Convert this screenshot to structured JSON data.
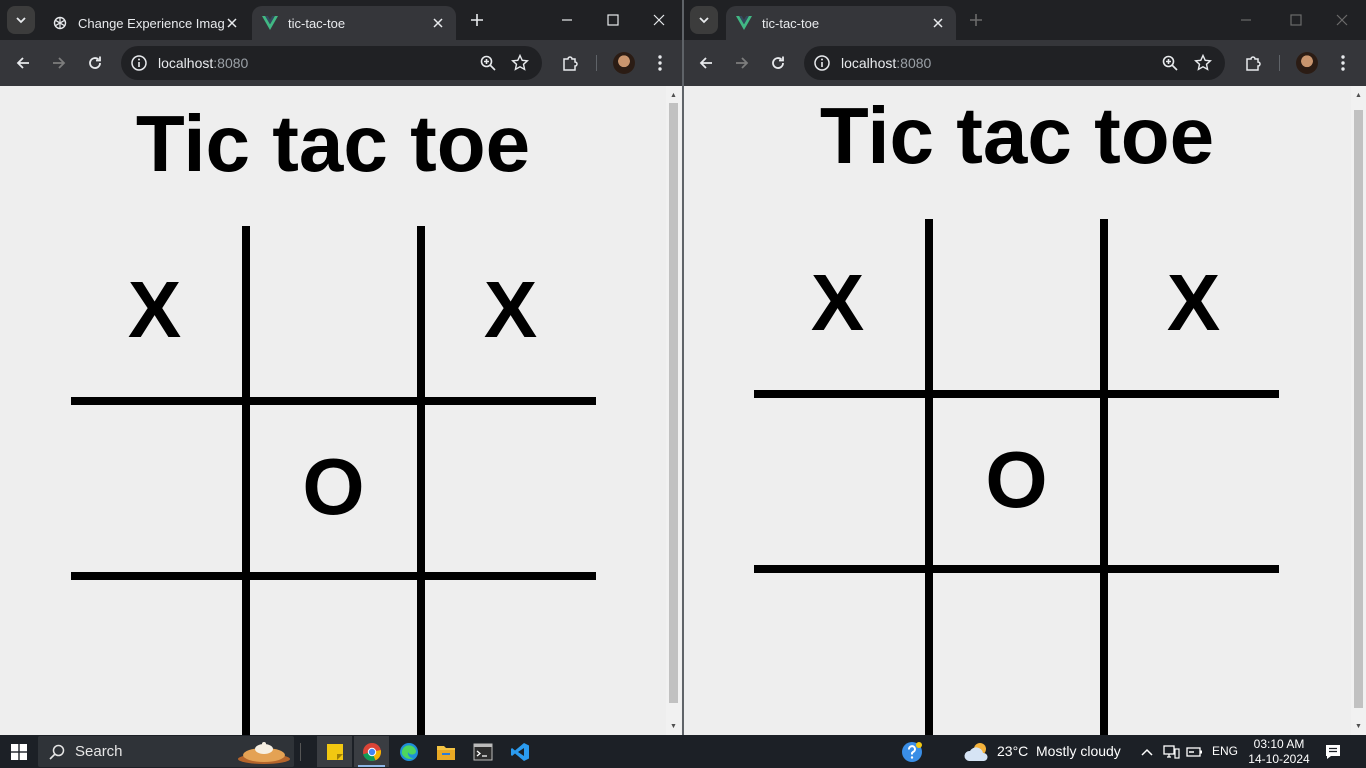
{
  "left_window": {
    "tabs": [
      {
        "title": "Change Experience Image",
        "active": false,
        "icon": "chatgpt-logo-icon"
      },
      {
        "title": "tic-tac-toe",
        "active": true,
        "icon": "vue-logo-icon"
      }
    ],
    "url_host": "localhost",
    "url_port": ":8080",
    "page": {
      "title": "Tic tac toe",
      "board": [
        "X",
        "",
        "X",
        "",
        "O",
        "",
        "",
        "",
        ""
      ]
    }
  },
  "right_window": {
    "tabs": [
      {
        "title": "tic-tac-toe",
        "active": true,
        "icon": "vue-logo-icon"
      }
    ],
    "url_host": "localhost",
    "url_port": ":8080",
    "page": {
      "title": "Tic tac toe",
      "board": [
        "X",
        "",
        "X",
        "",
        "O",
        "",
        "",
        "",
        ""
      ]
    }
  },
  "taskbar": {
    "search_label": "Search",
    "weather": {
      "temperature": "23°C",
      "condition": "Mostly cloudy"
    },
    "language": "ENG",
    "time": "03:10 AM",
    "date": "14-10-2024",
    "apps": [
      "sticky-notes-icon",
      "chrome-icon",
      "edge-icon",
      "file-explorer-icon",
      "terminal-icon",
      "vscode-icon"
    ]
  },
  "colors": {
    "chrome_frame": "#202124",
    "toolbar": "#35363a",
    "page_background": "#eeeeee",
    "board_line": "#000000",
    "vue_green": "#41b883",
    "taskbar": "#1c2026"
  }
}
